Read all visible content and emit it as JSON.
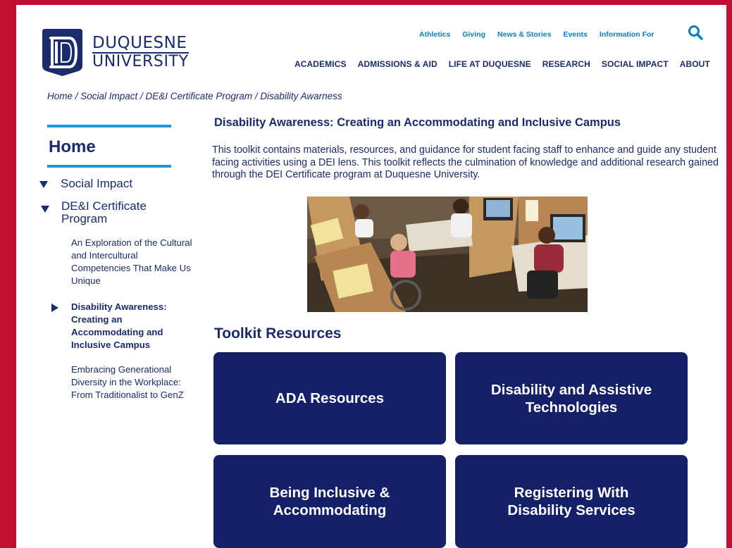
{
  "brand": {
    "name_line1": "DUQUESNE",
    "name_line2": "UNIVERSITY",
    "frame_color": "#c10f31",
    "navy": "#1a2c6b",
    "accent": "#1a9ad6"
  },
  "utility_nav": [
    "Athletics",
    "Giving",
    "News & Stories",
    "Events",
    "Information For"
  ],
  "main_nav": [
    "ACADEMICS",
    "ADMISSIONS & AID",
    "LIFE AT DUQUESNE",
    "RESEARCH",
    "SOCIAL IMPACT",
    "ABOUT"
  ],
  "breadcrumb": "Home / Social Impact / DE&I Certificate Program / Disability Awarness",
  "sidebar": {
    "home": "Home",
    "social_impact": "Social Impact",
    "certificate_program": "DE&I Certificate Program",
    "links": [
      "An Exploration of the Cultural and Intercultural Competencies That Make Us Unique",
      "Disability Awareness: Creating an Accommodating and Inclusive Campus",
      "Embracing Generational Diversity in the Workplace: From Traditionalist to GenZ"
    ]
  },
  "main": {
    "title": "Disability Awareness: Creating an Accommodating and Inclusive Campus",
    "intro": "This toolkit contains materials, resources, and guidance for student facing staff to enhance and guide any student facing activities using a DEI lens. This toolkit reflects the culmination of knowledge and additional research gained through the DEI Certificate program at Duquesne University.",
    "toolkit_title": "Toolkit Resources",
    "resources": [
      "ADA Resources",
      "Disability and Assistive Technologies",
      "Being Inclusive & Accommodating",
      "Registering With Disability Services"
    ]
  },
  "icons": {
    "search": "search-icon",
    "expanded": "triangle-down-icon",
    "current": "triangle-right-icon"
  }
}
